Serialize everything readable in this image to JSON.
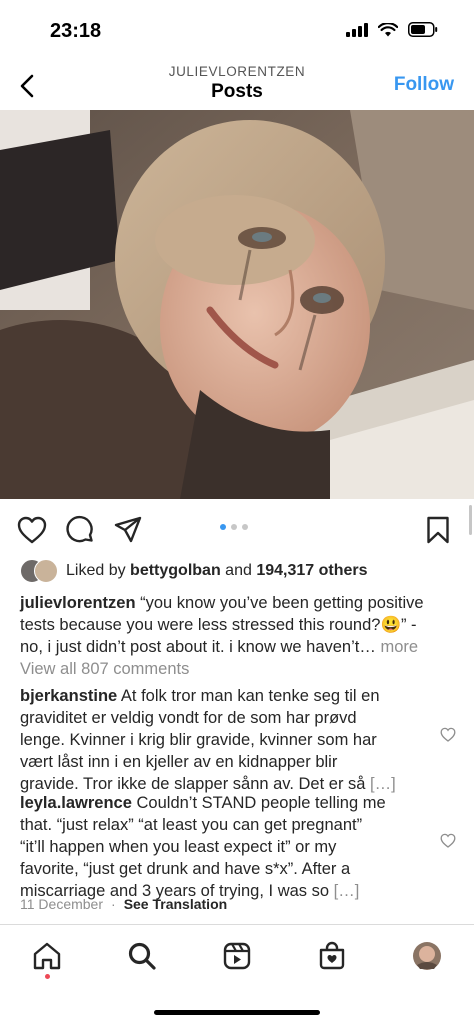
{
  "status_bar": {
    "time": "23:18"
  },
  "header": {
    "username": "JULIEVLORENTZEN",
    "title": "Posts",
    "follow_label": "Follow"
  },
  "post": {
    "carousel": {
      "count": 3,
      "active": 1
    },
    "likes": {
      "prefix": "Liked by",
      "user": "bettygolban",
      "and": "and",
      "others": "194,317 others"
    },
    "caption": {
      "username": "julievlorentzen",
      "line1": "“you know you’ve been getting positive",
      "line2": "tests because you were less stressed this round?😃” -",
      "line3": "no, i just didn’t post about it. i know we haven’t…",
      "more": "more"
    },
    "view_comments": "View all 807 comments",
    "comments": [
      {
        "username": "bjerkanstine",
        "first": "At folk tror man kan tenke seg til en",
        "lines": [
          "graviditet er veldig vondt for de som har prøvd",
          "lenge. Kvinner i krig blir gravide, kvinner som har",
          "vært låst inn i en kjeller av en kidnapper blir",
          "gravide. Tror ikke de slapper sånn av. Det er så"
        ],
        "more": "[…]"
      },
      {
        "username": "leyla.lawrence",
        "first": "Couldn’t STAND people telling me",
        "lines": [
          "that. “just relax” “at least you can get pregnant”",
          "“it’ll happen when you least expect it” or my",
          "favorite, “just get drunk and have s*x”. After a",
          "miscarriage and 3 years of trying, I was so"
        ],
        "more": "[…]"
      }
    ],
    "date": "11 December",
    "separator": "·",
    "see_translation": "See Translation"
  },
  "colors": {
    "accent": "#3897f0",
    "text": "#262626",
    "muted": "#8e8e8e",
    "notification": "#ed4956"
  },
  "icons": {
    "header": [
      "back-chevron-icon"
    ],
    "actions": [
      "heart-icon",
      "comment-icon",
      "share-icon",
      "bookmark-icon"
    ],
    "tabbar": [
      "home-icon",
      "search-icon",
      "reels-icon",
      "shop-icon",
      "profile-avatar"
    ]
  }
}
